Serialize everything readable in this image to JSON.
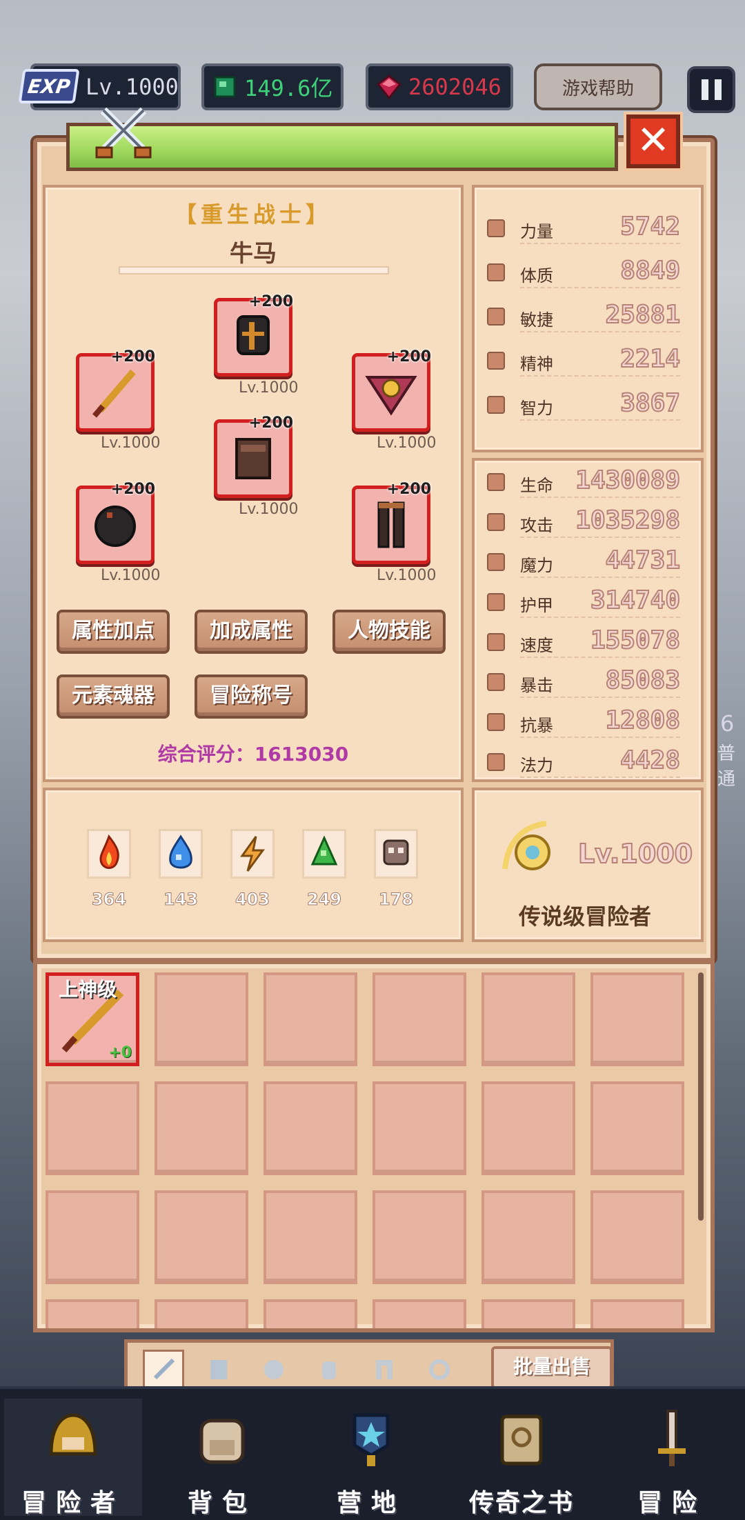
{
  "topbar": {
    "exp_label": "EXP",
    "level": "Lv.1000",
    "gems": "149.6亿",
    "rubies": "2602046",
    "help_label": "游戏帮助"
  },
  "character": {
    "class_title": "【重生战士】",
    "name": "牛马",
    "equipment": [
      {
        "slot": "helmet",
        "plus": "+200",
        "level": "Lv.1000"
      },
      {
        "slot": "weapon",
        "plus": "+200",
        "level": "Lv.1000"
      },
      {
        "slot": "amulet",
        "plus": "+200",
        "level": "Lv.1000"
      },
      {
        "slot": "armor",
        "plus": "+200",
        "level": "Lv.1000"
      },
      {
        "slot": "gloves",
        "plus": "+200",
        "level": "Lv.1000"
      },
      {
        "slot": "legs",
        "plus": "+200",
        "level": "Lv.1000"
      }
    ],
    "buttons": [
      "属性加点",
      "加成属性",
      "人物技能",
      "元素魂器",
      "冒险称号"
    ],
    "score": "综合评分：1613030"
  },
  "base_stats": [
    {
      "name": "力量",
      "value": "5742"
    },
    {
      "name": "体质",
      "value": "8849"
    },
    {
      "name": "敏捷",
      "value": "25881"
    },
    {
      "name": "精神",
      "value": "2214"
    },
    {
      "name": "智力",
      "value": "3867"
    }
  ],
  "combat_stats": [
    {
      "name": "生命",
      "value": "1430089"
    },
    {
      "name": "攻击",
      "value": "1035298"
    },
    {
      "name": "魔力",
      "value": "44731"
    },
    {
      "name": "护甲",
      "value": "314740"
    },
    {
      "name": "速度",
      "value": "155078"
    },
    {
      "name": "暴击",
      "value": "85083"
    },
    {
      "name": "抗暴",
      "value": "12808"
    },
    {
      "name": "法力",
      "value": "4428"
    }
  ],
  "elements": [
    {
      "icon": "fire-element-icon",
      "value": "364",
      "color": "#f04a1e"
    },
    {
      "icon": "water-element-icon",
      "value": "143",
      "color": "#3f8ee8"
    },
    {
      "icon": "lightning-element-icon",
      "value": "403",
      "color": "#f0a23a"
    },
    {
      "icon": "earth-element-icon",
      "value": "249",
      "color": "#3fb64a"
    },
    {
      "icon": "dark-element-icon",
      "value": "178",
      "color": "#8a7068"
    }
  ],
  "rank": {
    "level": "Lv.1000",
    "title": "传说级冒险者"
  },
  "inventory": {
    "first_item": {
      "grade": "上神级",
      "plus": "+0"
    },
    "batch_sell_label": "批量出售",
    "tabs": [
      "weapon",
      "armor",
      "skull",
      "helmet",
      "legs",
      "ring"
    ]
  },
  "side_hint": {
    "number": "6",
    "text": "普通"
  },
  "bottom_nav": [
    {
      "label": "冒险者",
      "icon": "adventurer-helmet-icon"
    },
    {
      "label": "背包",
      "icon": "backpack-icon"
    },
    {
      "label": "营地",
      "icon": "camp-banner-icon"
    },
    {
      "label": "传奇之书",
      "icon": "legend-book-icon"
    },
    {
      "label": "冒险",
      "icon": "sword-icon"
    }
  ],
  "colors": {
    "accent_red": "#d11f1f",
    "panel": "#f8dec0",
    "score_purple": "#b03aa5",
    "class_gold": "#d89a2a"
  }
}
